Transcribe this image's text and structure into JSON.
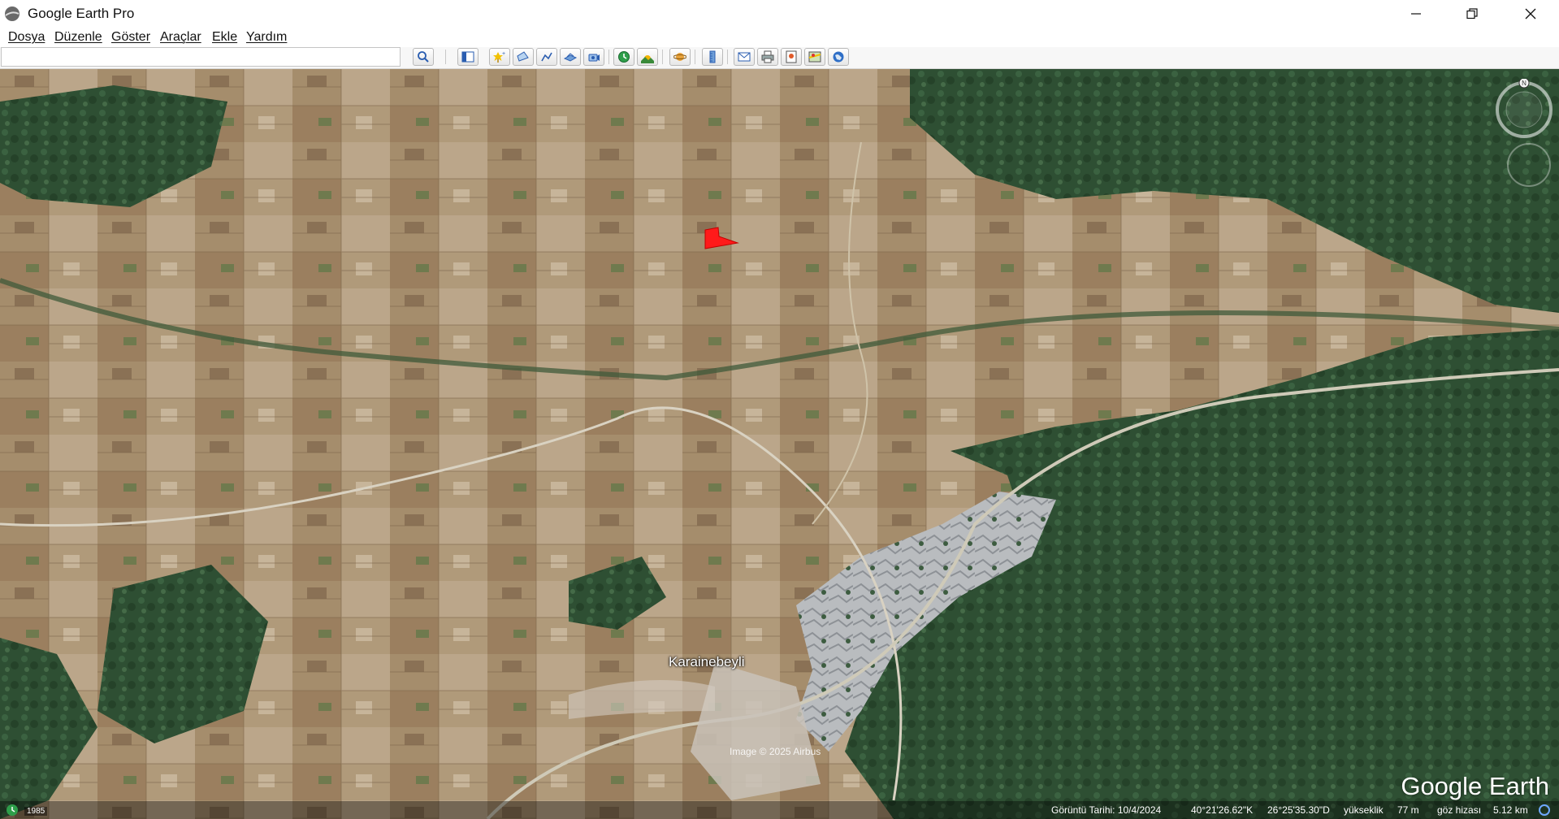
{
  "window": {
    "title": "Google Earth Pro"
  },
  "menubar": {
    "items": [
      "Dosya",
      "Düzenle",
      "Göster",
      "Araçlar",
      "Ekle",
      "Yardım"
    ]
  },
  "search": {
    "value": "",
    "placeholder": ""
  },
  "toolbar": {
    "buttons": [
      "search-icon",
      "sidebar-toggle-icon",
      "add-placemark-icon",
      "add-polygon-icon",
      "add-path-icon",
      "add-image-overlay-icon",
      "record-tour-icon",
      "historical-imagery-icon",
      "sunlight-icon",
      "planet-icon",
      "ruler-icon",
      "email-icon",
      "print-icon",
      "save-image-icon",
      "google-maps-icon",
      "earth-icon"
    ]
  },
  "map": {
    "place_label": "Karainebeyli",
    "copyright": "Image © 2025 Airbus",
    "watermark": "Google Earth",
    "colors": {
      "forest": "#2b4a30",
      "farmland": "#a68e6d",
      "rock": "#b8bcc0",
      "overlay": "#ff1a1a"
    }
  },
  "statusbar": {
    "year": "1985",
    "imagery_date": "Görüntü Tarihi: 10/4/2024",
    "latitude": "40°21'26.62\"K",
    "longitude": "26°25'35.30\"D",
    "elevation_label": "yükseklik",
    "elevation": "77 m",
    "eye_alt_label": "göz hizası",
    "eye_alt": "5.12 km"
  }
}
